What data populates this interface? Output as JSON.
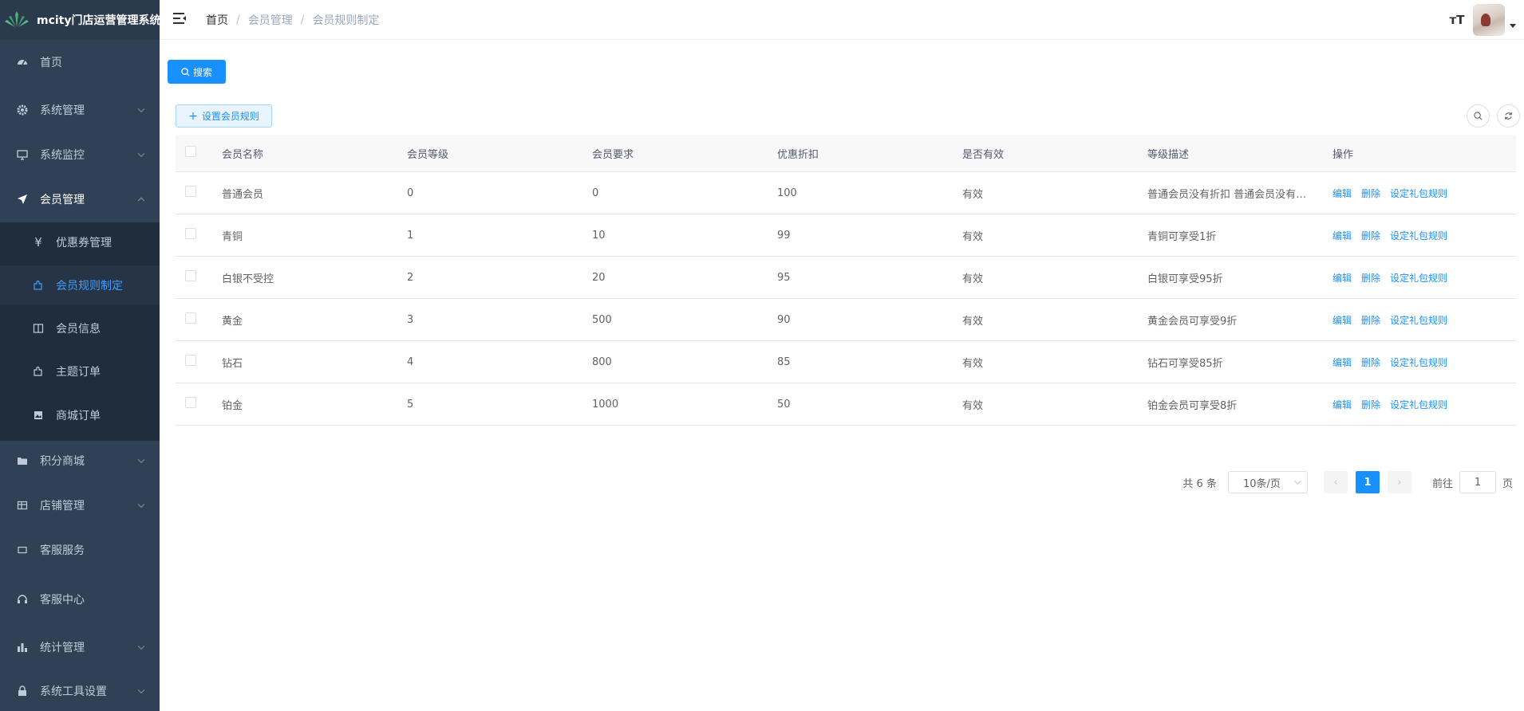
{
  "app": {
    "title": "mcity门店运营管理系统"
  },
  "sidebar": {
    "items": [
      {
        "label": "首页",
        "icon": "dashboard-icon"
      },
      {
        "label": "系统管理",
        "icon": "gear-icon"
      },
      {
        "label": "系统监控",
        "icon": "monitor-icon"
      },
      {
        "label": "会员管理",
        "icon": "paper-plane-icon",
        "expanded": true,
        "children": [
          {
            "label": "优惠券管理",
            "icon": "yen-icon"
          },
          {
            "label": "会员规则制定",
            "icon": "puzzle-icon",
            "active": true
          },
          {
            "label": "会员信息",
            "icon": "book-icon"
          },
          {
            "label": "主题订单",
            "icon": "puzzle-icon"
          },
          {
            "label": "商城订单",
            "icon": "image-icon"
          }
        ]
      },
      {
        "label": "积分商城",
        "icon": "folder-icon"
      },
      {
        "label": "店铺管理",
        "icon": "table-icon"
      },
      {
        "label": "客服服务",
        "icon": "card-icon"
      },
      {
        "label": "客服中心",
        "icon": "headset-icon"
      },
      {
        "label": "统计管理",
        "icon": "bar-chart-icon"
      },
      {
        "label": "系统工具设置",
        "icon": "lock-icon"
      }
    ]
  },
  "breadcrumb": [
    "首页",
    "会员管理",
    "会员规则制定"
  ],
  "header": {
    "size_icon": "тT"
  },
  "toolbar": {
    "search_label": "搜索",
    "add_label": "设置会员规则"
  },
  "table": {
    "columns": [
      "会员名称",
      "会员等级",
      "会员要求",
      "优惠折扣",
      "是否有效",
      "等级描述",
      "操作"
    ],
    "rows": [
      [
        "普通会员",
        "0",
        "0",
        "100",
        "有效",
        "普通会员没有折扣 普通会员没有折扣"
      ],
      [
        "青铜",
        "1",
        "10",
        "99",
        "有效",
        "青铜可享受1折"
      ],
      [
        "白银不受控",
        "2",
        "20",
        "95",
        "有效",
        "白银可享受95折"
      ],
      [
        "黄金",
        "3",
        "500",
        "90",
        "有效",
        "黄金会员可享受9折"
      ],
      [
        "钻石",
        "4",
        "800",
        "85",
        "有效",
        "钻石可享受85折"
      ],
      [
        "铂金",
        "5",
        "1000",
        "50",
        "有效",
        "铂金会员可享受8折"
      ]
    ],
    "ops": [
      "编辑",
      "删除",
      "设定礼包规则"
    ]
  },
  "pagination": {
    "total_text": "共 6 条",
    "page_size": "10条/页",
    "current_page": "1",
    "goto_label": "前往",
    "goto_value": "1",
    "page_suffix": "页"
  },
  "colors": {
    "sidebar_bg": "#304156",
    "accent": "#1890ff",
    "active_text": "#409eff"
  }
}
